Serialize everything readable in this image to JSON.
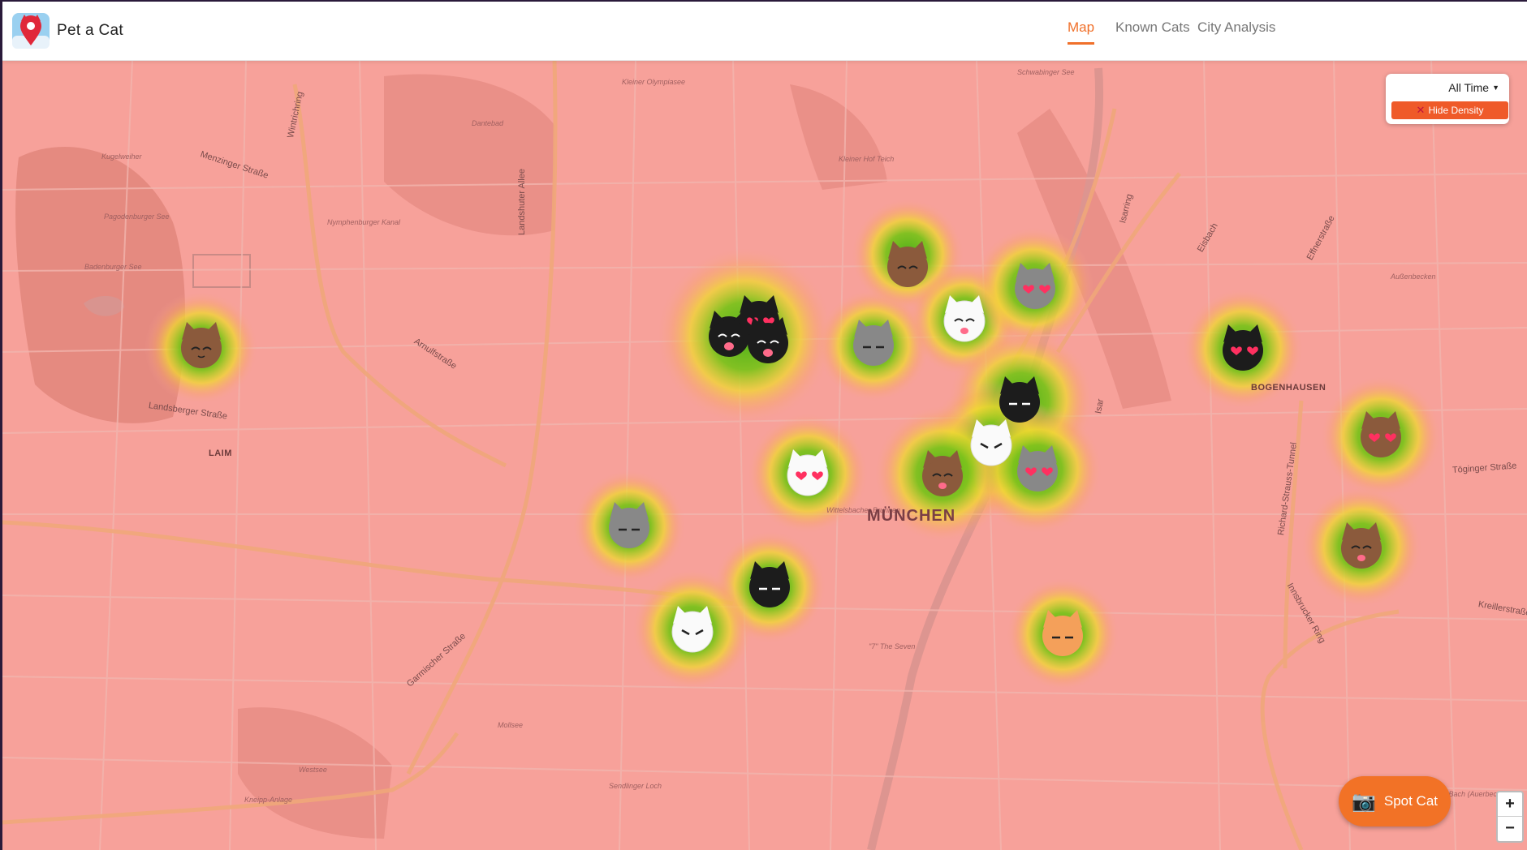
{
  "app": {
    "name": "Pet a Cat"
  },
  "nav": {
    "tabs": [
      {
        "label": "Map",
        "active": true
      },
      {
        "label": "Known Cats",
        "active": false
      },
      {
        "label": "City Analysis",
        "active": false
      }
    ]
  },
  "controls": {
    "time_filter": "All Time",
    "density_toggle": "Hide Density",
    "spot_button": "Spot Cat",
    "zoom_in": "+",
    "zoom_out": "−"
  },
  "map": {
    "city_label": "MÜNCHEN",
    "districts": [
      "LAIM",
      "BOGENHAUSEN"
    ],
    "places": [
      "Kleiner Olympiasee",
      "Schwabinger See",
      "Dantebad",
      "Kugelweiher",
      "Pagodenburger See",
      "Badenburger See",
      "Nymphenburger Kanal",
      "Kleiner Hof Teich",
      "Außenbecken",
      "Wittelsbacher Brunnen",
      "\"7\" The Seven",
      "Mollsee",
      "Westsee",
      "Kneipp-Anlage",
      "Sendlinger Loch",
      "Auer Bach (Auerbecken)"
    ],
    "streets": [
      "Menzinger Straße",
      "Wintrichring",
      "Landshuter Allee",
      "Arnulfstraße",
      "Landsberger Straße",
      "Garmischer Straße",
      "Isarring",
      "Effnerstraße",
      "Richard-Strauss-Tunnel",
      "Töginger Straße",
      "Innsbrucker Ring",
      "Kreillerstraße",
      "Eisbach",
      "Isar"
    ],
    "colors": {
      "base": "#f7a19a",
      "heat_low": "#f5d43a",
      "heat_high": "#5bb81f",
      "accent": "#f27226"
    },
    "cats": [
      {
        "name": "cat-brown-closed"
      },
      {
        "name": "cat-black-happy"
      },
      {
        "name": "cat-black-heart"
      },
      {
        "name": "cat-black-happy-2"
      },
      {
        "name": "cat-gray-sleepy"
      },
      {
        "name": "cat-brown-smile"
      },
      {
        "name": "cat-white-smile"
      },
      {
        "name": "cat-gray-heart"
      },
      {
        "name": "cat-black-heart-eyes"
      },
      {
        "name": "cat-black-sleepy"
      },
      {
        "name": "cat-white-angry"
      },
      {
        "name": "cat-gray-heart-2"
      },
      {
        "name": "cat-brown-laugh"
      },
      {
        "name": "cat-white-heart"
      },
      {
        "name": "cat-gray-sleepy-2"
      },
      {
        "name": "cat-black-sleepy-2"
      },
      {
        "name": "cat-white-angry-2"
      },
      {
        "name": "cat-orange-sleepy"
      },
      {
        "name": "cat-brown-heart"
      },
      {
        "name": "cat-brown-laugh-2"
      }
    ]
  }
}
